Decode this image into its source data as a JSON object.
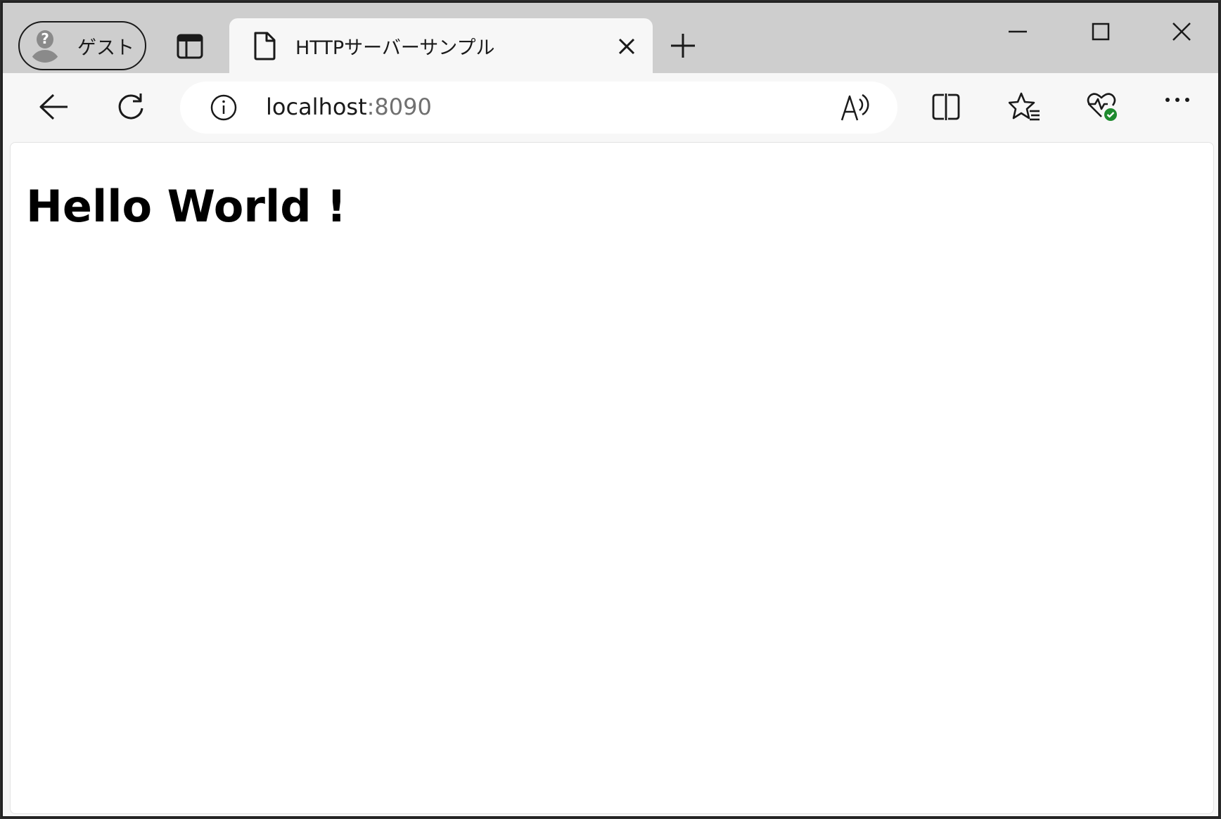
{
  "browser": {
    "profile": {
      "label": "ゲスト",
      "icon": "guest-avatar-icon"
    },
    "tab": {
      "title": "HTTPサーバーサンプル",
      "icon": "document-icon"
    },
    "address": {
      "host": "localhost",
      "port": ":8090",
      "site_info_icon": "info-icon"
    },
    "toolbar_icons": [
      "back-arrow-icon",
      "refresh-icon",
      "read-aloud-icon",
      "split-screen-icon",
      "favorites-icon",
      "browser-essentials-icon",
      "more-icon"
    ],
    "window_controls": [
      "minimize-icon",
      "maximize-icon",
      "close-icon"
    ],
    "colors": {
      "chrome": "#cecece",
      "toolbar": "#f7f7f7",
      "status_green": "#1e8a2e"
    }
  },
  "page": {
    "heading": "Hello World !"
  }
}
